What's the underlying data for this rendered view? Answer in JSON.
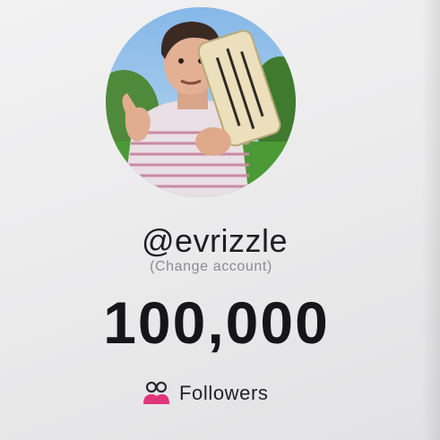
{
  "profile": {
    "handle": "@evrizzle",
    "change_account": "(Change account)",
    "follower_count": "100,000",
    "followers_label": "Followers"
  },
  "icons": {
    "followers": "people-icon"
  },
  "colors": {
    "icon_accent": "#e0357a"
  }
}
